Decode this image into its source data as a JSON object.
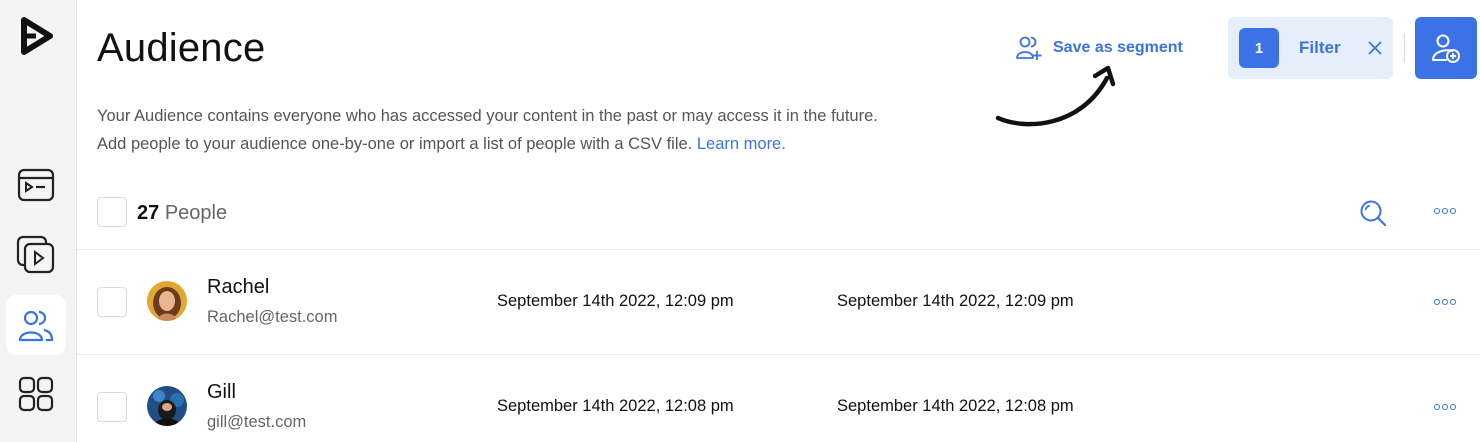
{
  "page": {
    "title": "Audience",
    "description_line1": "Your Audience contains everyone who has accessed your content in the past or may access it in the future.",
    "description_line2": "Add people to your audience one-by-one or import a list of people with a CSV file.",
    "learn_more": "Learn more."
  },
  "sidebar": {
    "items": [
      {
        "icon": "logo-icon"
      },
      {
        "icon": "playlist-icon"
      },
      {
        "icon": "media-library-icon"
      },
      {
        "icon": "audience-icon",
        "active": true
      },
      {
        "icon": "apps-grid-icon"
      }
    ]
  },
  "toolbar": {
    "save_segment_label": "Save as segment",
    "filter_count": "1",
    "filter_label": "Filter"
  },
  "list": {
    "count": "27",
    "count_label": "People",
    "rows": [
      {
        "name": "Rachel",
        "email": "Rachel@test.com",
        "date1": "September 14th 2022, 12:09 pm",
        "date2": "September 14th 2022, 12:09 pm"
      },
      {
        "name": "Gill",
        "email": "gill@test.com",
        "date1": "September 14th 2022, 12:08 pm",
        "date2": "September 14th 2022, 12:08 pm"
      }
    ]
  },
  "colors": {
    "accent": "#3b73e6",
    "filter_bg": "#e6eefc",
    "sidebar_bg": "#f4f4f4"
  }
}
